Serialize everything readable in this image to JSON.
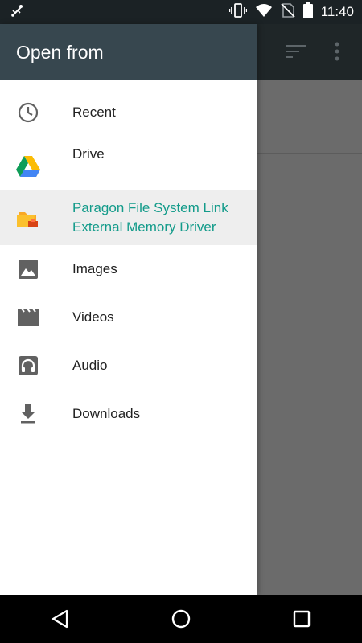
{
  "status_bar": {
    "time": "11:40",
    "icons": [
      "usb-debug-icon",
      "vibrate-icon",
      "wifi-icon",
      "no-sim-icon",
      "battery-icon"
    ]
  },
  "drawer": {
    "title": "Open from",
    "items": [
      {
        "label": "Recent",
        "icon": "clock-icon"
      },
      {
        "label": "Drive",
        "icon": "google-drive-icon"
      },
      {
        "label_line1": "Paragon File System Link",
        "label_line2": "External Memory Driver",
        "icon": "paragon-folder-icon",
        "selected": true
      },
      {
        "label": "Images",
        "icon": "image-icon"
      },
      {
        "label": "Videos",
        "icon": "movie-icon"
      },
      {
        "label": "Audio",
        "icon": "headphones-icon"
      },
      {
        "label": "Downloads",
        "icon": "download-icon"
      }
    ]
  },
  "background_toolbar": {
    "icons": [
      "sort-icon",
      "more-vert-icon"
    ]
  },
  "nav_bar": {
    "buttons": [
      "back-icon",
      "home-icon",
      "recents-icon"
    ]
  },
  "colors": {
    "drawer_header": "#37474f",
    "accent_selected_text": "#139b8a",
    "status_bar": "#1b2225",
    "scrim": "#6b6b6b"
  }
}
